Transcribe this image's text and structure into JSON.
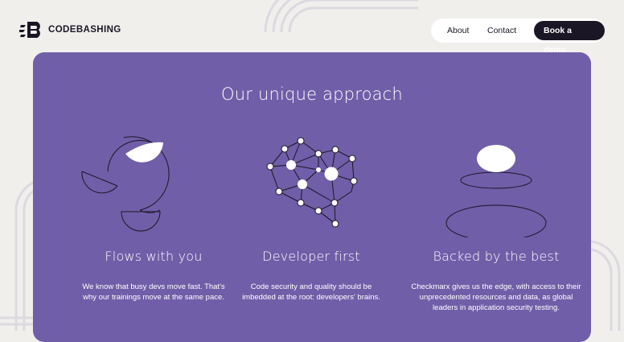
{
  "brand": {
    "name": "CODEBASHING"
  },
  "nav": {
    "about": "About",
    "contact": "Contact",
    "book_demo": "Book a demo"
  },
  "section": {
    "title": "Our unique approach",
    "features": [
      {
        "title": "Flows with you",
        "description": "We know that busy devs move fast. That's why our trainings move at the same pace."
      },
      {
        "title": "Developer first",
        "description": "Code security and quality should be imbedded at the root: developers' brains."
      },
      {
        "title": "Backed by the best",
        "description": "Checkmarx gives us the edge, with access to their unprecedented resources and data, as global leaders in application security testing."
      }
    ]
  },
  "colors": {
    "card": "#705ea8",
    "page": "#f0efec",
    "dark": "#1a1625",
    "arcs": "#dedbe3"
  }
}
